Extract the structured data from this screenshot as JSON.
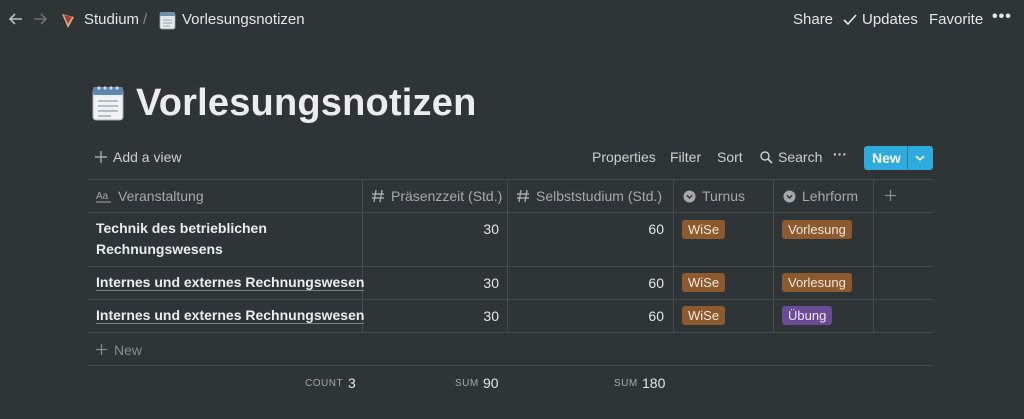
{
  "breadcrumb": {
    "workspace": "Studium",
    "separator": "/",
    "page": "Vorlesungsnotizen"
  },
  "topbar": {
    "share": "Share",
    "updates": "Updates",
    "favorite": "Favorite",
    "more": "•••"
  },
  "page": {
    "title": "Vorlesungsnotizen",
    "icon": "notepad-icon"
  },
  "toolbar": {
    "add_view": "Add a view",
    "properties": "Properties",
    "filter": "Filter",
    "sort": "Sort",
    "search": "Search",
    "more": "···",
    "new": "New"
  },
  "table": {
    "columns": [
      "Veranstaltung",
      "Präsenzzeit (Std.)",
      "Selbststudium (Std.)",
      "Turnus",
      "Lehrform"
    ],
    "rows": [
      {
        "title_line1": "Technik des betrieblichen",
        "title_line2": "Rechnungswesens",
        "praesenz": "30",
        "selbst": "60",
        "turnus": "WiSe",
        "lehrform": "Vorlesung"
      },
      {
        "title_line1": "Internes und externes Rechnungswesen",
        "praesenz": "30",
        "selbst": "60",
        "turnus": "WiSe",
        "lehrform": "Vorlesung"
      },
      {
        "title_line1": "Internes und externes Rechnungswesen",
        "praesenz": "30",
        "selbst": "60",
        "turnus": "WiSe",
        "lehrform": "Übung"
      }
    ],
    "add_row": "New",
    "footer": {
      "count_label": "COUNT",
      "count_value": "3",
      "sum1_label": "SUM",
      "sum1_value": "90",
      "sum2_label": "SUM",
      "sum2_value": "180"
    }
  },
  "colors": {
    "background": "#2f3437",
    "accent": "#2eaadc",
    "tag_brown": "#8c5a2e",
    "tag_purple": "#6a4b95"
  }
}
